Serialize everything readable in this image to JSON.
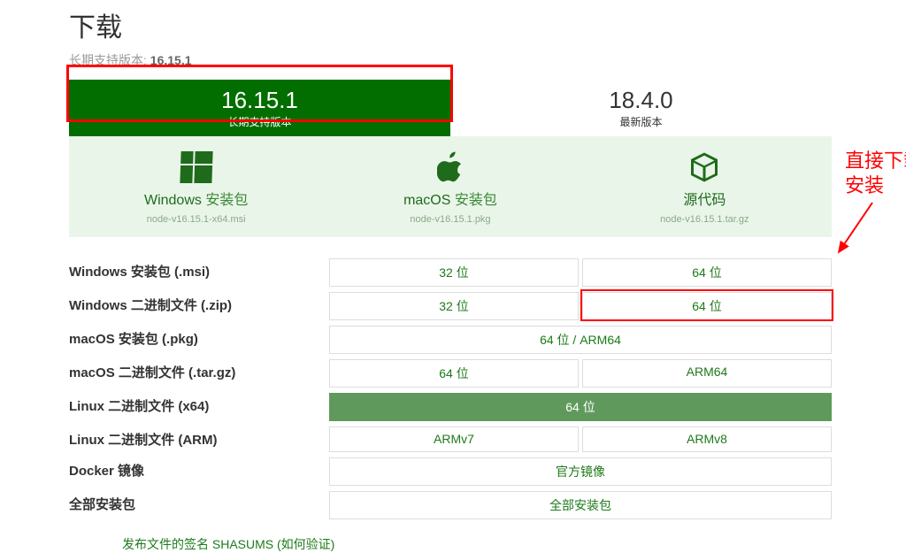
{
  "title": "下载",
  "lts_prefix": "长期支持版本: ",
  "lts_version": "16.15.1",
  "tabs": {
    "lts": {
      "version": "16.15.1",
      "label": "长期支持版本"
    },
    "latest": {
      "version": "18.4.0",
      "label": "最新版本"
    }
  },
  "cards": {
    "windows": {
      "label_a": "Windows ",
      "label_b": "安装包",
      "file": "node-v16.15.1-x64.msi"
    },
    "macos": {
      "label_a": "macOS ",
      "label_b": "安装包",
      "file": "node-v16.15.1.pkg"
    },
    "source": {
      "label_a": "源代码",
      "label_b": "",
      "file": "node-v16.15.1.tar.gz"
    }
  },
  "annotation": {
    "line1": "直接下载",
    "line2": "安装"
  },
  "matrix": [
    {
      "name": "Windows 安装包 (.msi)",
      "cells": [
        {
          "t": "32 位"
        },
        {
          "t": "64 位"
        }
      ]
    },
    {
      "name": "Windows 二进制文件 (.zip)",
      "cells": [
        {
          "t": "32 位"
        },
        {
          "t": "64 位",
          "hl": true
        }
      ]
    },
    {
      "name": "macOS 安装包 (.pkg)",
      "cells": [
        {
          "t": "64 位 / ARM64",
          "span": 2
        }
      ]
    },
    {
      "name": "macOS 二进制文件 (.tar.gz)",
      "cells": [
        {
          "t": "64 位"
        },
        {
          "t": "ARM64"
        }
      ]
    },
    {
      "name": "Linux 二进制文件 (x64)",
      "cells": [
        {
          "t": "64 位",
          "span": 2,
          "filled": true
        }
      ]
    },
    {
      "name": "Linux 二进制文件 (ARM)",
      "cells": [
        {
          "t": "ARMv7"
        },
        {
          "t": "ARMv8"
        }
      ]
    },
    {
      "name": "Docker 镜像",
      "cells": [
        {
          "t": "官方镜像",
          "span": 2
        }
      ]
    },
    {
      "name": "全部安装包",
      "cells": [
        {
          "t": "全部安装包",
          "span": 2
        }
      ]
    }
  ],
  "bottom_link": "发布文件的签名 SHASUMS (如何验证)"
}
